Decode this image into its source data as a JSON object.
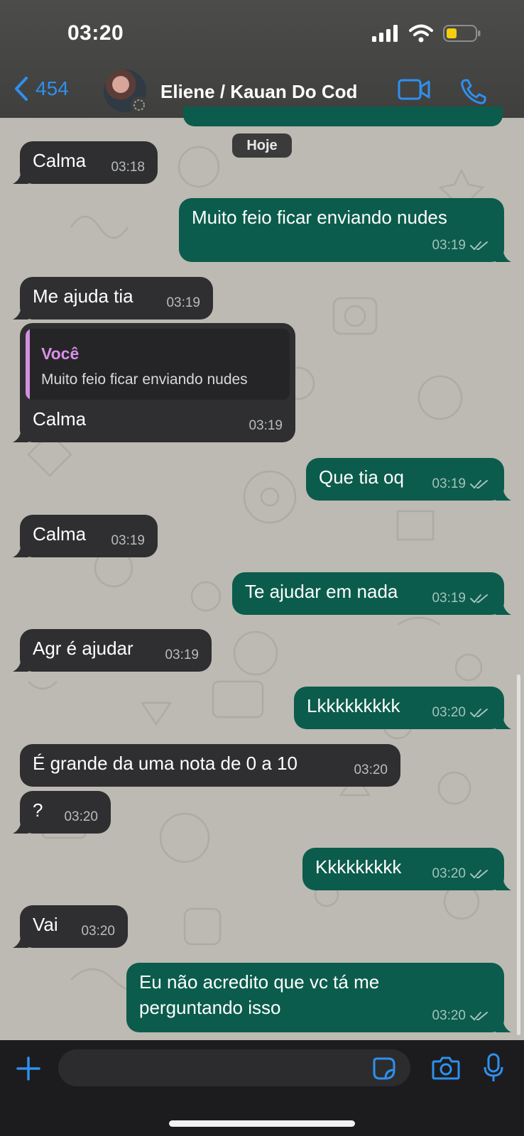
{
  "status_bar": {
    "time": "03:20"
  },
  "header": {
    "back_count": "454",
    "contact_name": "Eliene / Kauan Do Cod"
  },
  "date_chip": "Hoje",
  "messages": [
    {
      "dir": "in",
      "text": "Calma",
      "time": "03:18"
    },
    {
      "dir": "out",
      "text": "Muito feio ficar enviando nudes",
      "time": "03:19"
    },
    {
      "dir": "in",
      "text": "Me ajuda tia",
      "time": "03:19"
    },
    {
      "dir": "in",
      "text": "Calma",
      "time": "03:19",
      "quote_author": "Você",
      "quote_text": "Muito feio ficar enviando nudes"
    },
    {
      "dir": "out",
      "text": "Que tia oq",
      "time": "03:19"
    },
    {
      "dir": "in",
      "text": "Calma",
      "time": "03:19"
    },
    {
      "dir": "out",
      "text": "Te ajudar em nada",
      "time": "03:19"
    },
    {
      "dir": "in",
      "text": "Agr é ajudar",
      "time": "03:19"
    },
    {
      "dir": "out",
      "text": "Lkkkkkkkkk",
      "time": "03:20"
    },
    {
      "dir": "in",
      "text": "É grande da uma nota de 0 a 10",
      "time": "03:20"
    },
    {
      "dir": "in",
      "text": "?",
      "time": "03:20"
    },
    {
      "dir": "out",
      "text": "Kkkkkkkkk",
      "time": "03:20"
    },
    {
      "dir": "in",
      "text": "Vai",
      "time": "03:20"
    },
    {
      "dir": "out",
      "text_line1": "Eu não acredito que vc tá me",
      "text_line2": "perguntando isso",
      "time": "03:20"
    }
  ],
  "composer": {
    "placeholder": ""
  },
  "colors": {
    "accent": "#2e90ee",
    "outgoing_bubble": "#0b5c4c",
    "incoming_bubble": "#2f2f31",
    "quote_author": "#d88fe8"
  }
}
